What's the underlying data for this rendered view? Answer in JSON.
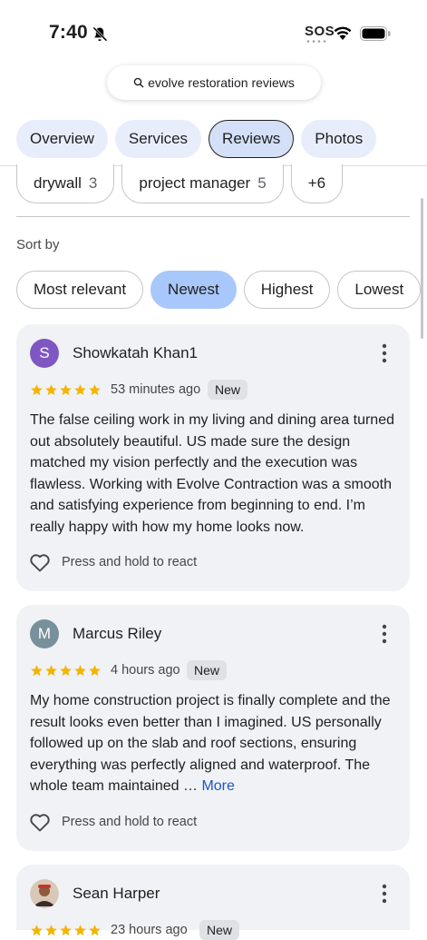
{
  "status_bar": {
    "time": "7:40",
    "sos": "SOS"
  },
  "search": {
    "query": "evolve restoration reviews"
  },
  "tabs": [
    {
      "label": "Overview"
    },
    {
      "label": "Services"
    },
    {
      "label": "Reviews",
      "active": true
    },
    {
      "label": "Photos"
    }
  ],
  "topics": [
    {
      "label": "drywall",
      "count": "3"
    },
    {
      "label": "project manager",
      "count": "5"
    },
    {
      "label": "+6"
    }
  ],
  "sort": {
    "label": "Sort by",
    "options": [
      {
        "label": "Most relevant"
      },
      {
        "label": "Newest",
        "active": true
      },
      {
        "label": "Highest"
      },
      {
        "label": "Lowest"
      }
    ]
  },
  "reviews": [
    {
      "initial": "S",
      "avatar_color": "#7e57c2",
      "name": "Showkatah Khan1",
      "rating": 5,
      "time": "53 minutes ago",
      "badge": "New",
      "text": "The false ceiling work in my living and dining area turned out absolutely beautiful. US made sure the design matched my vision perfectly and the execution was flawless. Working with Evolve Contraction was a smooth and satisfying experience from beginning to end. I’m really happy with how my home looks now.",
      "react_label": "Press and hold to react"
    },
    {
      "initial": "M",
      "avatar_color": "#78909c",
      "name": "Marcus Riley",
      "rating": 5,
      "time": "4 hours ago",
      "badge": "New",
      "text": "My home construction project is finally complete and the result looks even better than I imagined. US personally followed up on the slab and roof sections, ensuring everything was perfectly aligned and waterproof. The whole team maintained …",
      "more_label": "More",
      "react_label": "Press and hold to react"
    },
    {
      "name": "Sean Harper",
      "rating": 5,
      "time": "23 hours ago",
      "badge": "New"
    }
  ],
  "colors": {
    "star": "#f4b400",
    "accent": "#a8c7fa",
    "tab_bg": "#e8edfb",
    "link": "#1a56c9"
  },
  "icons": [
    "bell-slash-icon",
    "wifi-icon",
    "battery-icon",
    "search-icon",
    "more-vert-icon",
    "heart-icon",
    "star-icon"
  ]
}
